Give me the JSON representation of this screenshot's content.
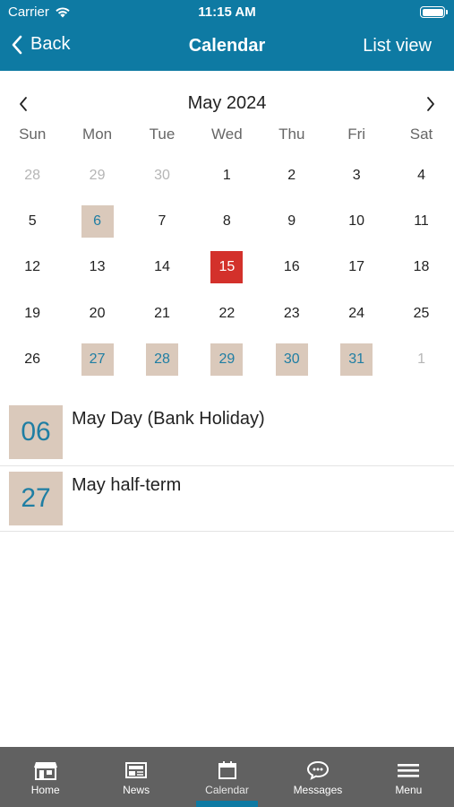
{
  "status_bar": {
    "carrier": "Carrier",
    "time": "11:15 AM",
    "wifi_icon": "wifi-icon",
    "battery_icon": "battery-icon"
  },
  "nav": {
    "back_label": "Back",
    "title": "Calendar",
    "right_label": "List view"
  },
  "calendar": {
    "month_label": "May 2024",
    "weekdays": [
      "Sun",
      "Mon",
      "Tue",
      "Wed",
      "Thu",
      "Fri",
      "Sat"
    ],
    "weeks": [
      [
        {
          "d": "28",
          "state": "muted"
        },
        {
          "d": "29",
          "state": "muted"
        },
        {
          "d": "30",
          "state": "muted"
        },
        {
          "d": "1",
          "state": ""
        },
        {
          "d": "2",
          "state": ""
        },
        {
          "d": "3",
          "state": ""
        },
        {
          "d": "4",
          "state": ""
        }
      ],
      [
        {
          "d": "5",
          "state": ""
        },
        {
          "d": "6",
          "state": "event"
        },
        {
          "d": "7",
          "state": ""
        },
        {
          "d": "8",
          "state": ""
        },
        {
          "d": "9",
          "state": ""
        },
        {
          "d": "10",
          "state": ""
        },
        {
          "d": "11",
          "state": ""
        }
      ],
      [
        {
          "d": "12",
          "state": ""
        },
        {
          "d": "13",
          "state": ""
        },
        {
          "d": "14",
          "state": ""
        },
        {
          "d": "15",
          "state": "today"
        },
        {
          "d": "16",
          "state": ""
        },
        {
          "d": "17",
          "state": ""
        },
        {
          "d": "18",
          "state": ""
        }
      ],
      [
        {
          "d": "19",
          "state": ""
        },
        {
          "d": "20",
          "state": ""
        },
        {
          "d": "21",
          "state": ""
        },
        {
          "d": "22",
          "state": ""
        },
        {
          "d": "23",
          "state": ""
        },
        {
          "d": "24",
          "state": ""
        },
        {
          "d": "25",
          "state": ""
        }
      ],
      [
        {
          "d": "26",
          "state": ""
        },
        {
          "d": "27",
          "state": "event"
        },
        {
          "d": "28",
          "state": "event"
        },
        {
          "d": "29",
          "state": "event"
        },
        {
          "d": "30",
          "state": "event"
        },
        {
          "d": "31",
          "state": "event"
        },
        {
          "d": "1",
          "state": "muted"
        }
      ]
    ]
  },
  "events": [
    {
      "date": "06",
      "title": "May Day (Bank Holiday)"
    },
    {
      "date": "27",
      "title": "May half-term"
    }
  ],
  "tabbar": {
    "items": [
      {
        "label": "Home",
        "icon": "home-icon",
        "active": false
      },
      {
        "label": "News",
        "icon": "news-icon",
        "active": false
      },
      {
        "label": "Calendar",
        "icon": "calendar-icon",
        "active": true
      },
      {
        "label": "Messages",
        "icon": "messages-icon",
        "active": false
      },
      {
        "label": "Menu",
        "icon": "menu-icon",
        "active": false
      }
    ]
  },
  "colors": {
    "header": "#0e7aa3",
    "event_highlight": "#dac9bb",
    "event_text": "#1f7ea3",
    "today": "#d3312b",
    "tabbar": "#616161"
  }
}
